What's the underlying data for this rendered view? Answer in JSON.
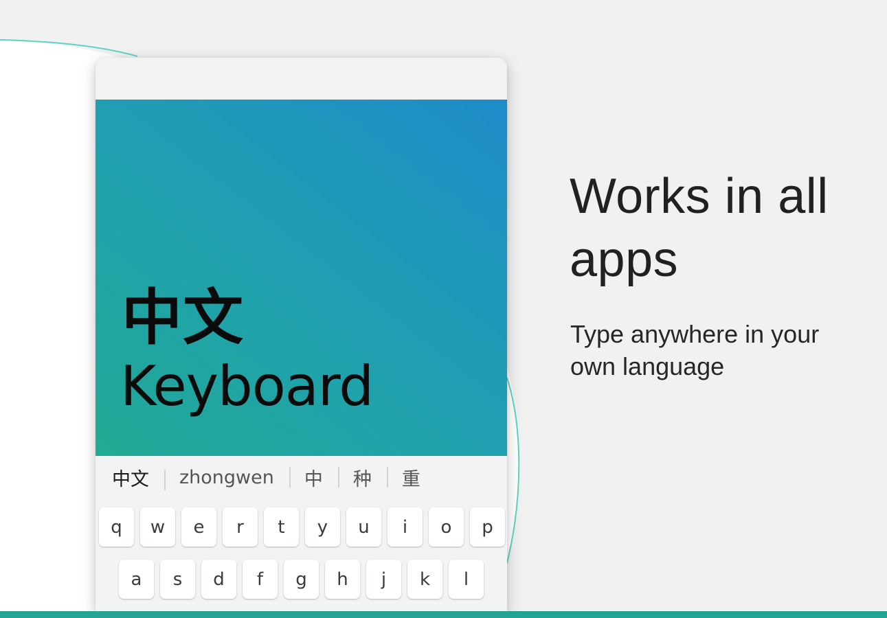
{
  "hero": {
    "title_cn": "中文",
    "title_en": "Keyboard"
  },
  "suggestions": [
    "中文",
    "zhongwen",
    "中",
    "种",
    "重"
  ],
  "keyboard": {
    "row1": [
      "q",
      "w",
      "e",
      "r",
      "t",
      "y",
      "u",
      "i",
      "o",
      "p"
    ],
    "row2": [
      "a",
      "s",
      "d",
      "f",
      "g",
      "h",
      "j",
      "k",
      "l"
    ]
  },
  "headline": "Works in all apps",
  "subtitle": "Type anywhere in your own language",
  "colors": {
    "accent": "#23a493",
    "gradient_top": "#1e8bc9",
    "gradient_bottom": "#21aa94",
    "background": "#f1f1f2"
  }
}
